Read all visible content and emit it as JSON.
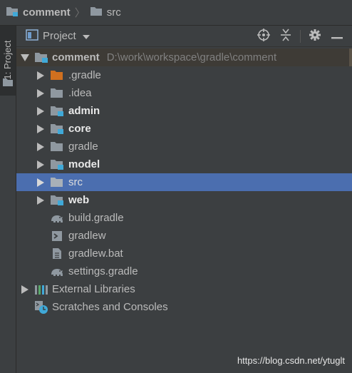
{
  "breadcrumb": {
    "root": "comment",
    "child": "src"
  },
  "stripe": {
    "tab_label": "1: Project"
  },
  "toolwindow": {
    "view_label": "Project"
  },
  "tree": {
    "root": {
      "label": "comment",
      "path": "D:\\work\\workspace\\gradle\\comment"
    },
    "items": [
      {
        "label": ".gradle"
      },
      {
        "label": ".idea"
      },
      {
        "label": "admin"
      },
      {
        "label": "core"
      },
      {
        "label": "gradle"
      },
      {
        "label": "model"
      },
      {
        "label": "src"
      },
      {
        "label": "web"
      },
      {
        "label": "build.gradle"
      },
      {
        "label": "gradlew"
      },
      {
        "label": "gradlew.bat"
      },
      {
        "label": "settings.gradle"
      }
    ],
    "external_libraries": "External Libraries",
    "scratches": "Scratches and Consoles"
  },
  "colors": {
    "background": "#3c3f41",
    "selection": "#4b6eaf",
    "folder": "#8f98a0",
    "excluded_folder": "#d0701f",
    "module_badge": "#40a9d8"
  },
  "watermark": "https://blog.csdn.net/ytuglt"
}
